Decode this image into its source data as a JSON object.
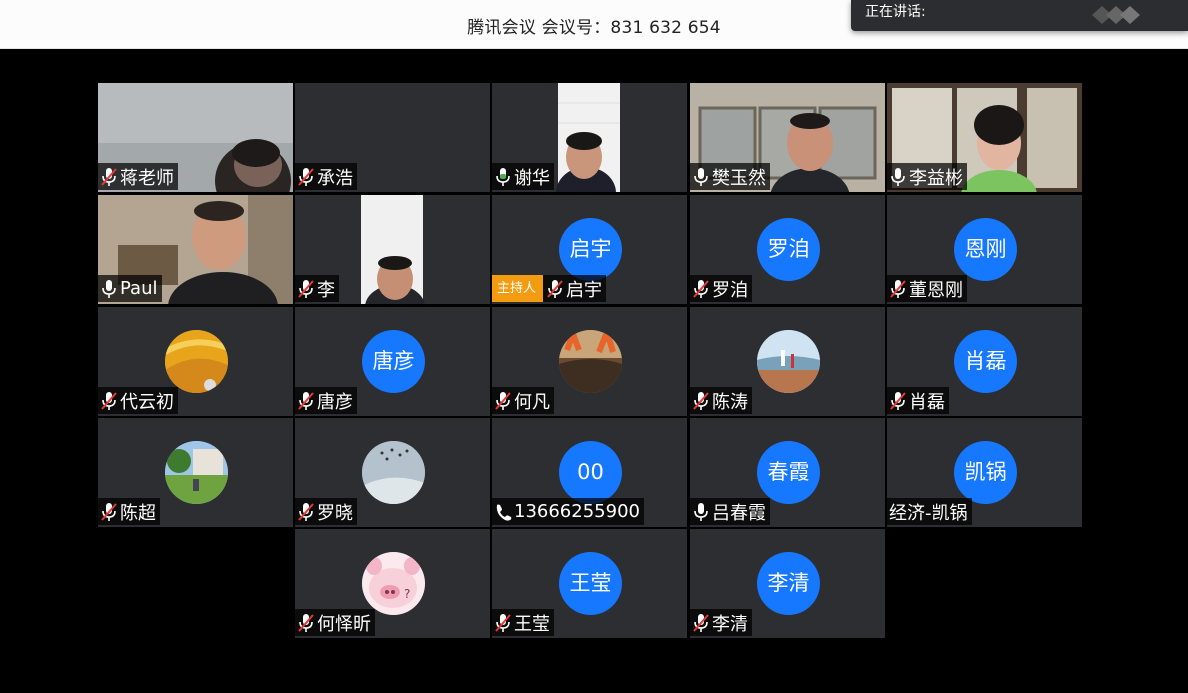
{
  "header": {
    "title": "腾讯会议 会议号：831 632 654"
  },
  "speaking_panel": {
    "label": "正在讲话:"
  },
  "participants": [
    {
      "name": "蒋老师",
      "mic": "muted"
    },
    {
      "name": "承浩",
      "mic": "muted"
    },
    {
      "name": "谢华",
      "mic": "on"
    },
    {
      "name": "樊玉然",
      "mic": "on"
    },
    {
      "name": "李益彬",
      "mic": "on"
    },
    {
      "name": "Paul",
      "mic": "on"
    },
    {
      "name": "李",
      "mic": "muted"
    },
    {
      "name": "启宇",
      "mic": "muted",
      "avatar_text": "启宇",
      "role_badge": "主持人"
    },
    {
      "name": "罗洎",
      "mic": "muted",
      "avatar_text": "罗洎"
    },
    {
      "name": "董恩刚",
      "mic": "muted",
      "avatar_text": "恩刚"
    },
    {
      "name": "代云初",
      "mic": "muted"
    },
    {
      "name": "唐彦",
      "mic": "muted",
      "avatar_text": "唐彦"
    },
    {
      "name": "何凡",
      "mic": "muted"
    },
    {
      "name": "陈涛",
      "mic": "muted"
    },
    {
      "name": "肖磊",
      "mic": "muted",
      "avatar_text": "肖磊"
    },
    {
      "name": "陈超",
      "mic": "muted"
    },
    {
      "name": "罗晓",
      "mic": "muted"
    },
    {
      "name": "13666255900",
      "mic": "phone",
      "avatar_text": "00"
    },
    {
      "name": "吕春霞",
      "mic": "on",
      "avatar_text": "春霞"
    },
    {
      "name": "经济-凯锅",
      "mic": "none",
      "avatar_text": "凯锅"
    },
    {
      "name": "何怿昕",
      "mic": "muted"
    },
    {
      "name": "王莹",
      "mic": "muted",
      "avatar_text": "王莹"
    },
    {
      "name": "李清",
      "mic": "muted",
      "avatar_text": "李清"
    }
  ],
  "colors": {
    "avatar_blue": "#1677ff",
    "host_badge": "#f39c12",
    "mute_red": "#e53935"
  }
}
